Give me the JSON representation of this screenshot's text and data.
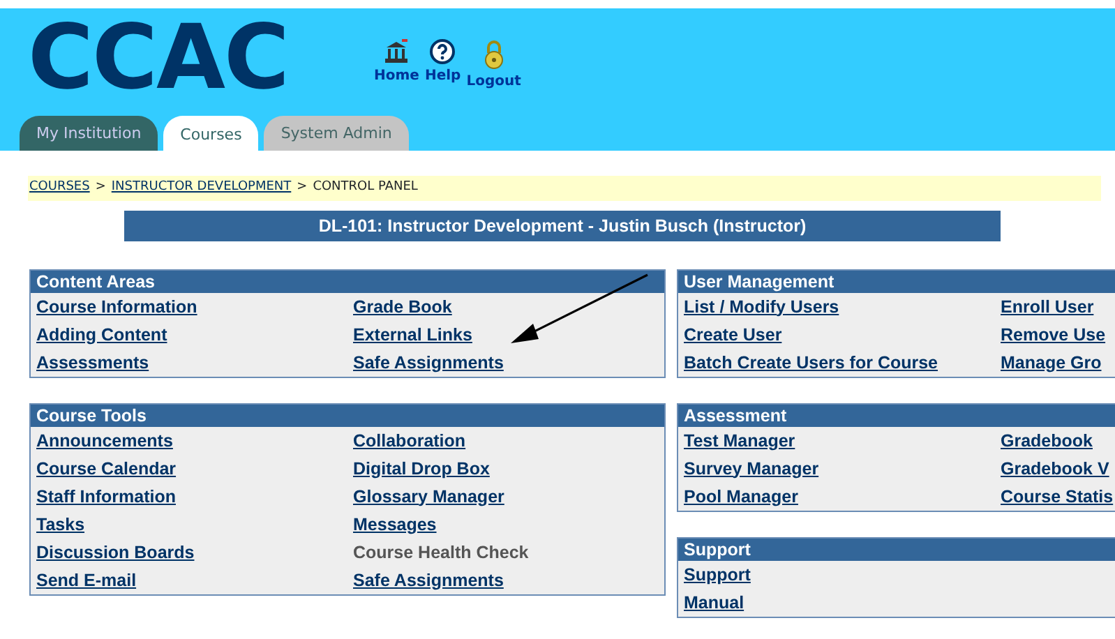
{
  "header": {
    "logo": "CCAC",
    "nav_links": [
      {
        "kind": "home",
        "label": "Home"
      },
      {
        "kind": "help",
        "label": "Help"
      },
      {
        "kind": "logout",
        "label": "Logout"
      }
    ]
  },
  "tabs": [
    {
      "label": "My Institution",
      "selected": false,
      "kind": "dark"
    },
    {
      "label": "Courses",
      "selected": true,
      "kind": "light"
    },
    {
      "label": "System Admin",
      "selected": false,
      "kind": "grey"
    }
  ],
  "breadcrumb": {
    "separator": ">",
    "items": [
      {
        "label": "COURSES",
        "link": true
      },
      {
        "label": "INSTRUCTOR DEVELOPMENT",
        "link": true
      },
      {
        "label": "CONTROL PANEL",
        "link": false
      }
    ]
  },
  "course_title": "DL-101:  Instructor Development -  Justin Busch (Instructor)",
  "left_panels": [
    {
      "title": "Content Areas",
      "rows": [
        [
          {
            "label": "Course Information",
            "disabled": false
          },
          {
            "label": "Grade Book",
            "disabled": false
          }
        ],
        [
          {
            "label": "Adding Content",
            "disabled": false
          },
          {
            "label": "External Links",
            "disabled": false
          }
        ],
        [
          {
            "label": "Assessments",
            "disabled": false
          },
          {
            "label": "Safe Assignments",
            "disabled": false
          }
        ]
      ]
    },
    {
      "title": "Course Tools",
      "rows": [
        [
          {
            "label": "Announcements",
            "disabled": false
          },
          {
            "label": "Collaboration",
            "disabled": false
          }
        ],
        [
          {
            "label": "Course Calendar",
            "disabled": false
          },
          {
            "label": "Digital Drop Box",
            "disabled": false
          }
        ],
        [
          {
            "label": "Staff Information",
            "disabled": false
          },
          {
            "label": "Glossary Manager",
            "disabled": false
          }
        ],
        [
          {
            "label": "Tasks",
            "disabled": false
          },
          {
            "label": "Messages",
            "disabled": false
          }
        ],
        [
          {
            "label": "Discussion Boards",
            "disabled": false
          },
          {
            "label": "Course Health Check",
            "disabled": true
          }
        ],
        [
          {
            "label": "Send E-mail",
            "disabled": false
          },
          {
            "label": "Safe Assignments",
            "disabled": false
          }
        ]
      ]
    }
  ],
  "right_panels": [
    {
      "title": "User Management",
      "rows": [
        [
          {
            "label": "List / Modify Users",
            "disabled": false
          },
          {
            "label": "Enroll User",
            "disabled": false
          }
        ],
        [
          {
            "label": "Create User",
            "disabled": false
          },
          {
            "label": "Remove Use",
            "disabled": false
          }
        ],
        [
          {
            "label": "Batch Create Users for Course",
            "disabled": false
          },
          {
            "label": "Manage Gro",
            "disabled": false
          }
        ]
      ]
    },
    {
      "title": "Assessment",
      "rows": [
        [
          {
            "label": "Test Manager",
            "disabled": false
          },
          {
            "label": "Gradebook",
            "disabled": false
          }
        ],
        [
          {
            "label": "Survey Manager",
            "disabled": false
          },
          {
            "label": "Gradebook V",
            "disabled": false
          }
        ],
        [
          {
            "label": "Pool Manager",
            "disabled": false
          },
          {
            "label": "Course Statis",
            "disabled": false
          }
        ]
      ]
    },
    {
      "title": "Support",
      "rows": [
        [
          {
            "label": "Support",
            "disabled": false
          }
        ],
        [
          {
            "label": "Manual",
            "disabled": false
          }
        ]
      ]
    }
  ]
}
